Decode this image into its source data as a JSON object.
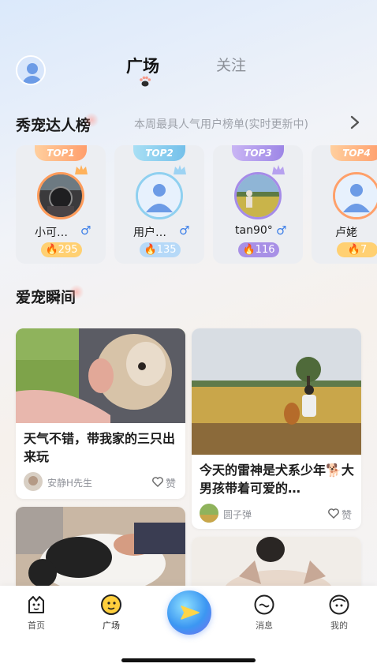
{
  "header": {
    "tabs": [
      {
        "label": "广场",
        "active": true
      },
      {
        "label": "关注",
        "active": false
      }
    ]
  },
  "ranking": {
    "title": "秀宠达人榜",
    "subtitle": "本周最具人气用户榜单(实时更新中)",
    "users": [
      {
        "badge": "TOP1",
        "name": "小可…",
        "gender": "♂",
        "heat": "295"
      },
      {
        "badge": "TOP2",
        "name": "用户…",
        "gender": "♂",
        "heat": "135"
      },
      {
        "badge": "TOP3",
        "name": "tan90°",
        "gender": "♂",
        "heat": "116"
      },
      {
        "badge": "TOP4",
        "name": "卢姥",
        "gender": "♂",
        "heat": "7"
      }
    ]
  },
  "moments": {
    "title": "爱宠瞬间",
    "posts": [
      {
        "title": "天气不错，带我家的三只出来玩",
        "author": "安静H先生",
        "like_label": "赞"
      },
      {
        "title": "今天的雷神是犬系少年🐕大男孩带着可爱的…",
        "author": "圆子弹",
        "like_label": "赞"
      }
    ]
  },
  "bottom_nav": {
    "items": [
      {
        "label": "首页",
        "icon": "home-icon"
      },
      {
        "label": "广场",
        "icon": "square-icon"
      },
      {
        "label": "",
        "icon": "publish-icon"
      },
      {
        "label": "消息",
        "icon": "message-icon"
      },
      {
        "label": "我的",
        "icon": "profile-icon"
      }
    ]
  },
  "colors": {
    "accent_blue": "#3d7fe8",
    "top1": "#ff9e6c",
    "top2": "#74c0ea",
    "top3": "#9d86e6",
    "heat_gold": "#ffd072"
  }
}
